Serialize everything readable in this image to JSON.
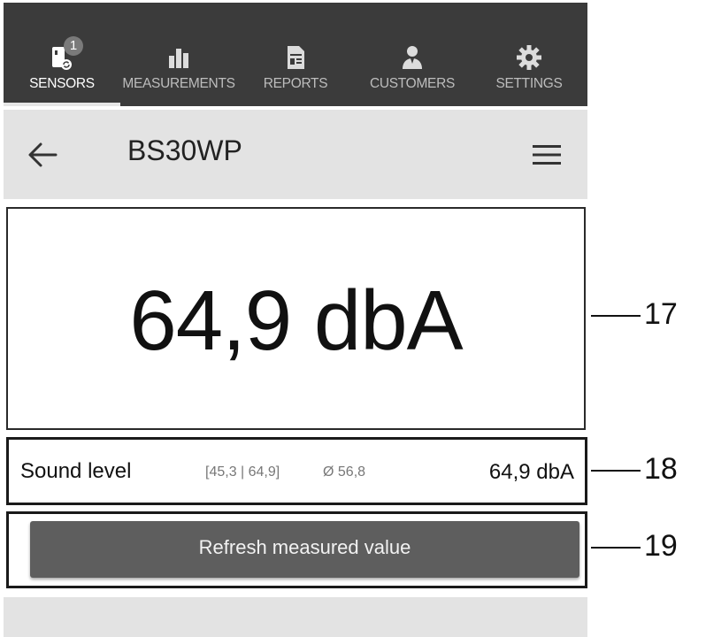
{
  "tabs": [
    {
      "label": "SENSORS",
      "icon": "sensor-icon",
      "badge": "1",
      "active": true
    },
    {
      "label": "MEASUREMENTS",
      "icon": "bar-chart-icon"
    },
    {
      "label": "REPORTS",
      "icon": "report-icon"
    },
    {
      "label": "CUSTOMERS",
      "icon": "customer-icon"
    },
    {
      "label": "SETTINGS",
      "icon": "gear-icon"
    }
  ],
  "header": {
    "title": "BS30WP",
    "back_icon": "arrow-left-icon",
    "menu_icon": "hamburger-menu-icon"
  },
  "main": {
    "big_value": "64,9 dbA"
  },
  "sound_level": {
    "label": "Sound level",
    "range": "[45,3 | 64,9]",
    "average": "Ø 56,8",
    "value": "64,9 dbA"
  },
  "refresh": {
    "label": "Refresh measured value"
  },
  "callouts": [
    "17",
    "18",
    "19"
  ],
  "colors": {
    "tabbar_bg": "#3b3b3b",
    "header_bg": "#e3e3e3",
    "button_bg": "#5e5e5e"
  }
}
